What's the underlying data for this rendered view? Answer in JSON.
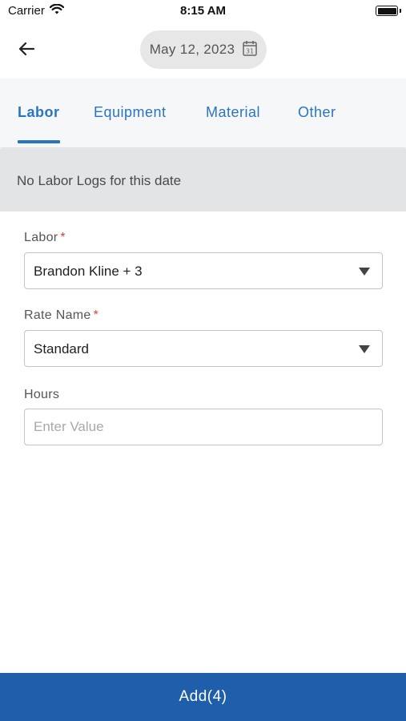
{
  "status_bar": {
    "carrier": "Carrier",
    "time": "8:15 AM"
  },
  "header": {
    "date": "May 12, 2023",
    "calendar_day": "31"
  },
  "tabs": [
    {
      "label": "Labor",
      "active": true
    },
    {
      "label": "Equipment",
      "active": false
    },
    {
      "label": "Material",
      "active": false
    },
    {
      "label": "Other",
      "active": false
    }
  ],
  "empty_message": "No Labor Logs for this date",
  "form": {
    "labor": {
      "label": "Labor",
      "required_mark": "*",
      "value": "Brandon Kline + 3"
    },
    "rate_name": {
      "label": "Rate Name",
      "required_mark": "*",
      "value": "Standard"
    },
    "hours": {
      "label": "Hours",
      "placeholder": "Enter Value",
      "value": ""
    }
  },
  "footer": {
    "button_label": "Add(4)"
  },
  "colors": {
    "accent": "#2a74c4",
    "footer": "#1e5eaa",
    "required": "#d64541"
  }
}
